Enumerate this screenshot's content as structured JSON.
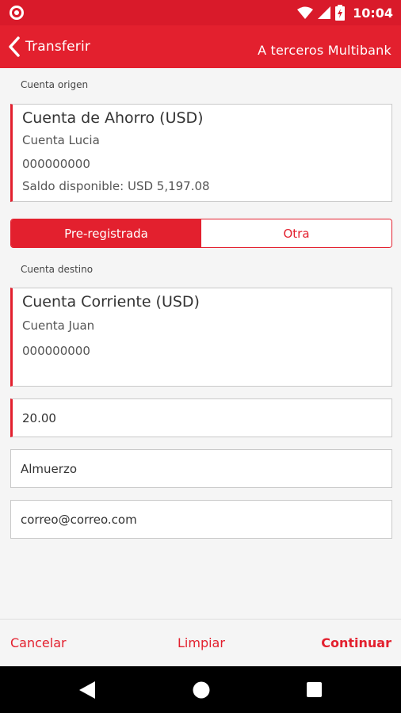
{
  "status": {
    "time": "10:04"
  },
  "header": {
    "back_label": "Transferir",
    "title": "A terceros Multibank"
  },
  "origin": {
    "section_label": "Cuenta origen",
    "account_type": "Cuenta de Ahorro (USD)",
    "account_name": "Cuenta Lucia",
    "account_number": "000000000",
    "balance": "Saldo disponible: USD 5,197.08"
  },
  "toggle": {
    "option1": "Pre-registrada",
    "option2": "Otra",
    "selected": "Pre-registrada"
  },
  "destination": {
    "section_label": "Cuenta destino",
    "account_type": "Cuenta Corriente (USD)",
    "account_name": "Cuenta Juan",
    "account_number": "000000000"
  },
  "form": {
    "amount": "20.00",
    "description": "Almuerzo",
    "email": "correo@correo.com"
  },
  "actions": {
    "cancel": "Cancelar",
    "clear": "Limpiar",
    "continue": "Continuar"
  },
  "colors": {
    "primary": "#e3202e",
    "statusbar": "#d91a2a"
  }
}
